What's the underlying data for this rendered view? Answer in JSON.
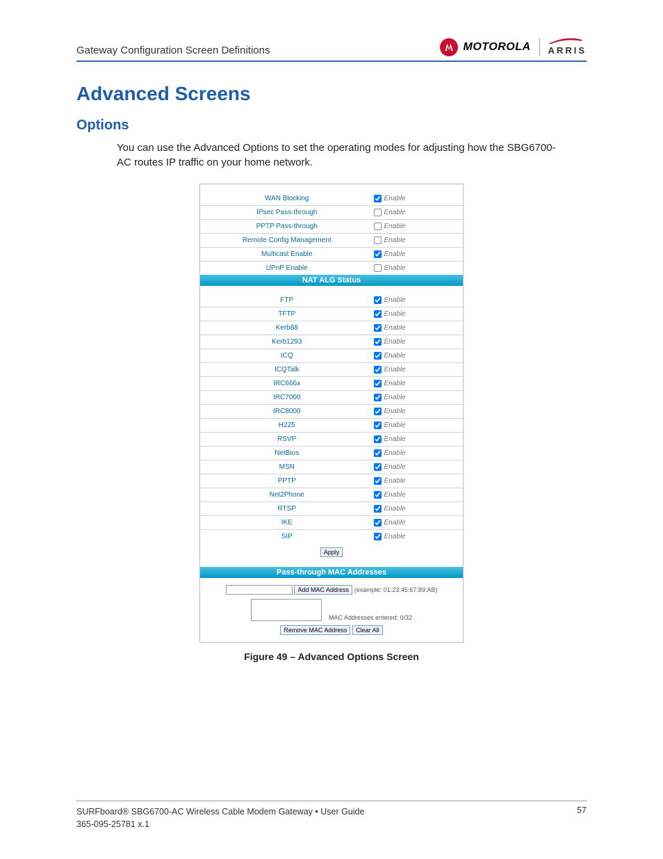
{
  "header": {
    "section_title": "Gateway Configuration Screen Definitions",
    "brand_primary": "MOTOROLA",
    "brand_secondary": "ARRIS"
  },
  "headings": {
    "h1": "Advanced Screens",
    "h2": "Options"
  },
  "paragraph": "You can use the Advanced Options to set the operating modes for adjusting how the SBG6700-AC routes IP traffic on your home network.",
  "enable_text": "Enable",
  "options_rows": [
    {
      "label": "WAN Blocking",
      "checked": true
    },
    {
      "label": "IPsec Pass-through",
      "checked": false
    },
    {
      "label": "PPTP Pass-through",
      "checked": false
    },
    {
      "label": "Remote Config Management",
      "checked": false
    },
    {
      "label": "Multicast Enable",
      "checked": true
    },
    {
      "label": "UPnP Enable",
      "checked": false
    }
  ],
  "nat_header": "NAT ALG Status",
  "nat_rows": [
    {
      "label": "FTP",
      "checked": true
    },
    {
      "label": "TFTP",
      "checked": true
    },
    {
      "label": "Kerb88",
      "checked": true
    },
    {
      "label": "Kerb1293",
      "checked": true
    },
    {
      "label": "ICQ",
      "checked": true
    },
    {
      "label": "ICQTalk",
      "checked": true
    },
    {
      "label": "IRC666x",
      "checked": true
    },
    {
      "label": "IRC7000",
      "checked": true
    },
    {
      "label": "IRC8000",
      "checked": true
    },
    {
      "label": "H225",
      "checked": true
    },
    {
      "label": "RSVP",
      "checked": true
    },
    {
      "label": "NetBios",
      "checked": true
    },
    {
      "label": "MSN",
      "checked": true
    },
    {
      "label": "PPTP",
      "checked": true
    },
    {
      "label": "Net2Phone",
      "checked": true
    },
    {
      "label": "RTSP",
      "checked": true
    },
    {
      "label": "IKE",
      "checked": true
    },
    {
      "label": "SIP",
      "checked": true
    }
  ],
  "buttons": {
    "apply": "Apply",
    "add_mac": "Add MAC Address",
    "remove_mac": "Remove MAC Address",
    "clear_all": "Clear All"
  },
  "mac_section": {
    "header": "Pass-through MAC Addresses",
    "example": "(example: 01:23:45:67:89:AB)",
    "count_label": "MAC Addresses entered: 0/32"
  },
  "caption": "Figure 49 – Advanced Options Screen",
  "footer": {
    "line1": "SURFboard® SBG6700-AC Wireless Cable Modem Gateway • User Guide",
    "line2": "365-095-25781 x.1",
    "page": "57"
  }
}
